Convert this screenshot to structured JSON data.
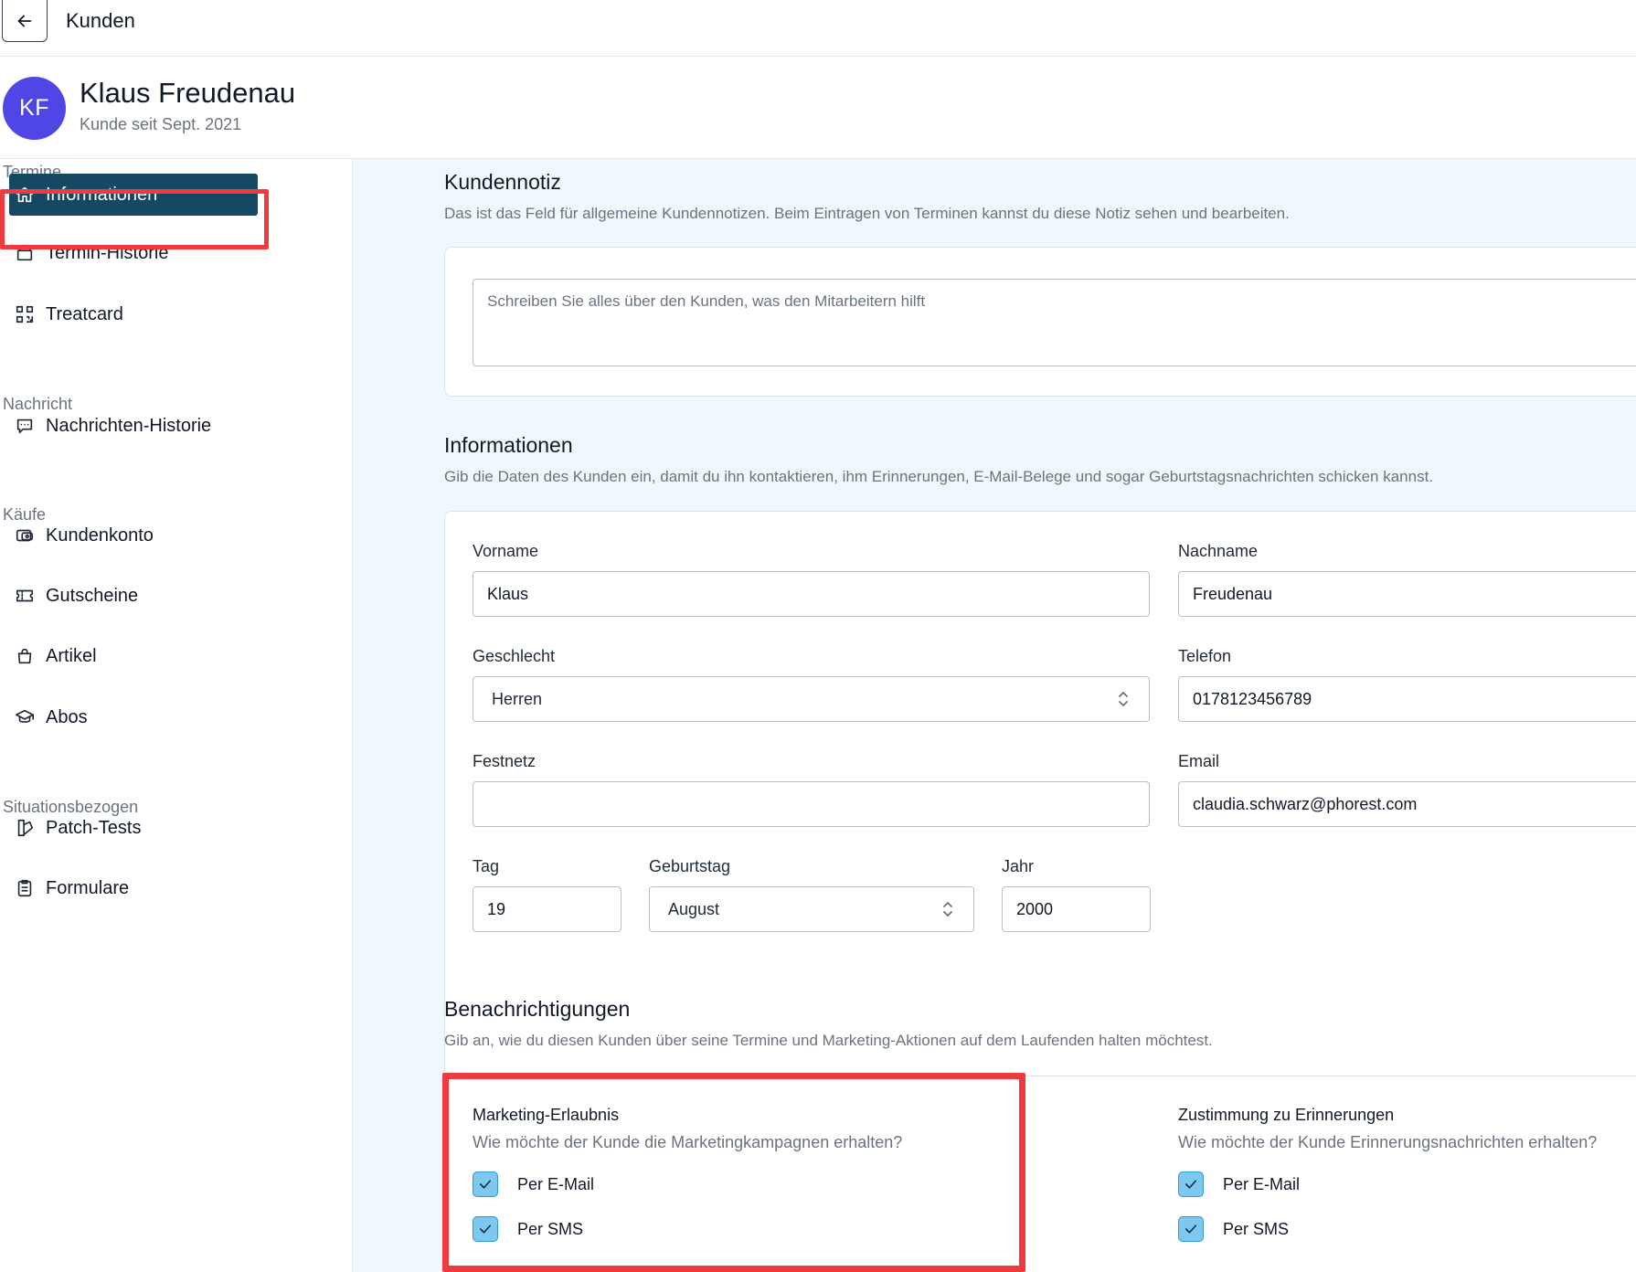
{
  "topbar": {
    "title": "Kunden"
  },
  "customer": {
    "initials": "KF",
    "name": "Klaus Freudenau",
    "since": "Kunde seit Sept. 2021"
  },
  "sidebar": {
    "sections": {
      "termine": "Termine",
      "nachricht": "Nachricht",
      "kaeufe": "Käufe",
      "situationsbezogen": "Situationsbezogen"
    },
    "items": [
      {
        "label": "Informationen",
        "icon": "home-icon",
        "active": true
      },
      {
        "label": "Termin-Historie",
        "icon": "calendar-stack-icon"
      },
      {
        "label": "Treatcard",
        "icon": "qr-code-icon"
      },
      {
        "label": "Nachrichten-Historie",
        "icon": "chat-bubble-icon"
      },
      {
        "label": "Kundenkonto",
        "icon": "wallet-icon"
      },
      {
        "label": "Gutscheine",
        "icon": "ticket-icon"
      },
      {
        "label": "Artikel",
        "icon": "shopping-bag-icon"
      },
      {
        "label": "Abos",
        "icon": "graduation-cap-icon"
      },
      {
        "label": "Patch-Tests",
        "icon": "patch-test-icon"
      },
      {
        "label": "Formulare",
        "icon": "clipboard-icon"
      }
    ]
  },
  "note": {
    "title": "Kundennotiz",
    "description": "Das ist das Feld für allgemeine Kundennotizen. Beim Eintragen von Terminen kannst du diese Notiz sehen und bearbeiten.",
    "placeholder": "Schreiben Sie alles über den Kunden, was den Mitarbeitern hilft"
  },
  "info": {
    "title": "Informationen",
    "description": "Gib die Daten des Kunden ein, damit du ihn kontaktieren, ihm Erinnerungen, E-Mail-Belege und sogar Geburtstagsnachrichten schicken kannst.",
    "fields": {
      "vorname": {
        "label": "Vorname",
        "value": "Klaus"
      },
      "nachname": {
        "label": "Nachname",
        "value": "Freudenau"
      },
      "geschlecht": {
        "label": "Geschlecht",
        "value": "Herren"
      },
      "telefon": {
        "label": "Telefon",
        "value": "0178123456789"
      },
      "festnetz": {
        "label": "Festnetz",
        "value": ""
      },
      "email": {
        "label": "Email",
        "value": "claudia.schwarz@phorest.com"
      },
      "tag": {
        "label": "Tag",
        "value": "19"
      },
      "geburtstag": {
        "label": "Geburtstag",
        "value": "August"
      },
      "jahr": {
        "label": "Jahr",
        "value": "2000"
      }
    }
  },
  "notifications": {
    "title": "Benachrichtigungen",
    "description": "Gib an, wie du diesen Kunden über seine Termine und Marketing-Aktionen auf dem Laufenden halten möchtest.",
    "marketing": {
      "title": "Marketing-Erlaubnis",
      "description": "Wie möchte der Kunde die Marketingkampagnen erhalten?",
      "email": "Per E-Mail",
      "sms": "Per SMS"
    },
    "reminders": {
      "title": "Zustimmung zu Erinnerungen",
      "description": "Wie möchte der Kunde Erinnerungsnachrichten erhalten?",
      "email": "Per E-Mail",
      "sms": "Per SMS"
    }
  },
  "colors": {
    "accent": "#164763",
    "avatar": "#4f46e5",
    "highlight": "#ef3b3f",
    "checkbox": "#7cc8ef"
  }
}
